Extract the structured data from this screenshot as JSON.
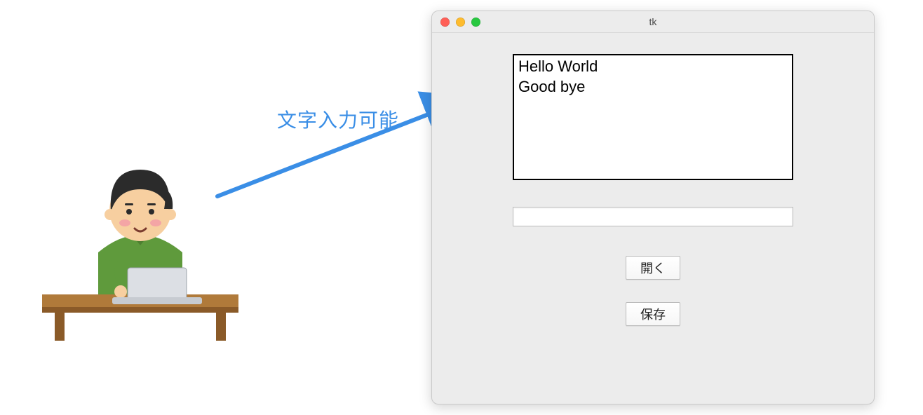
{
  "annotation": {
    "label": "文字入力可能"
  },
  "window": {
    "title": "tk",
    "textarea_value": "Hello World\nGood bye",
    "entry_value": "",
    "buttons": {
      "open": "開く",
      "save": "保存"
    }
  },
  "illustration": {
    "description": "person-typing-at-laptop"
  }
}
